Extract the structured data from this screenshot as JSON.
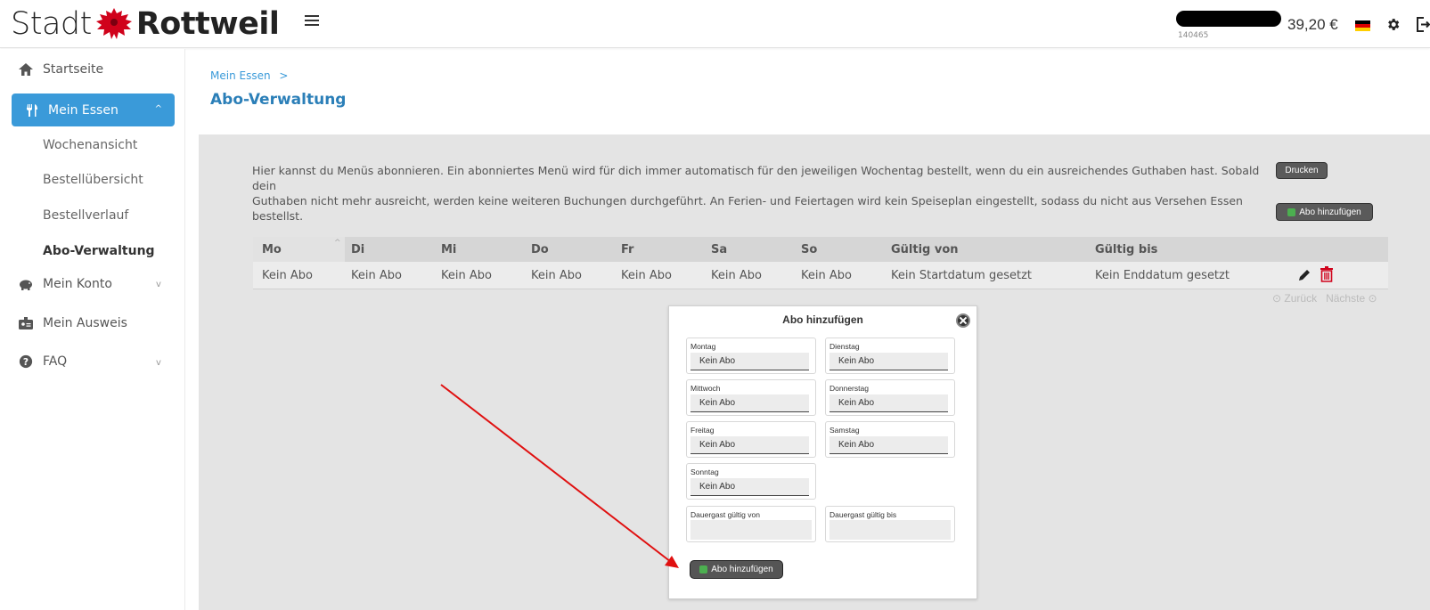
{
  "header": {
    "logo_left": "Stadt",
    "logo_right": "Rottweil",
    "user_id": "140465",
    "balance": "39,20 €"
  },
  "sidebar": {
    "items": [
      {
        "label": "Startseite",
        "icon": "home-icon"
      },
      {
        "label": "Mein Essen",
        "icon": "utensils-icon",
        "active": true
      },
      {
        "label": "Mein Konto",
        "icon": "piggy-bank-icon"
      },
      {
        "label": "Mein Ausweis",
        "icon": "id-card-icon"
      },
      {
        "label": "FAQ",
        "icon": "question-circle-icon"
      }
    ],
    "subitems": [
      "Wochenansicht",
      "Bestellübersicht",
      "Bestellverlauf",
      "Abo-Verwaltung"
    ]
  },
  "breadcrumb": {
    "label": "Mein Essen",
    "separator": ">"
  },
  "page_title": "Abo-Verwaltung",
  "info_text_line1": "Hier kannst du Menüs abonnieren. Ein abonniertes Menü wird für dich immer automatisch für den jeweiligen Wochentag bestellt, wenn du ein ausreichendes Guthaben hast. Sobald dein",
  "info_text_line2": "Guthaben nicht mehr ausreicht, werden keine weiteren Buchungen durchgeführt. An Ferien- und Feiertagen wird kein Speiseplan eingestellt, sodass du nicht aus Versehen Essen bestellst.",
  "buttons": {
    "print": "Drucken",
    "add_sub": "Abo hinzufügen"
  },
  "table": {
    "headers": [
      "Mo",
      "Di",
      "Mi",
      "Do",
      "Fr",
      "Sa",
      "So",
      "Gültig von",
      "Gültig bis"
    ],
    "row": [
      "Kein Abo",
      "Kein Abo",
      "Kein Abo",
      "Kein Abo",
      "Kein Abo",
      "Kein Abo",
      "Kein Abo",
      "Kein Startdatum gesetzt",
      "Kein Enddatum gesetzt"
    ]
  },
  "pager": {
    "prev": "Zurück",
    "next": "Nächste"
  },
  "modal": {
    "title": "Abo hinzufügen",
    "fields": [
      {
        "label": "Montag",
        "value": "Kein Abo"
      },
      {
        "label": "Dienstag",
        "value": "Kein Abo"
      },
      {
        "label": "Mittwoch",
        "value": "Kein Abo"
      },
      {
        "label": "Donnerstag",
        "value": "Kein Abo"
      },
      {
        "label": "Freitag",
        "value": "Kein Abo"
      },
      {
        "label": "Samstag",
        "value": "Kein Abo"
      },
      {
        "label": "Sonntag",
        "value": "Kein Abo"
      }
    ],
    "date_from_label": "Dauergast gültig von",
    "date_to_label": "Dauergast gültig bis",
    "submit": "Abo hinzufügen"
  },
  "colors": {
    "accent": "#3a9ad9",
    "title": "#2b7fb8",
    "panel": "#e4e4e4",
    "arrow": "#e01010",
    "trash": "#d0021b",
    "green": "#4caf50"
  }
}
